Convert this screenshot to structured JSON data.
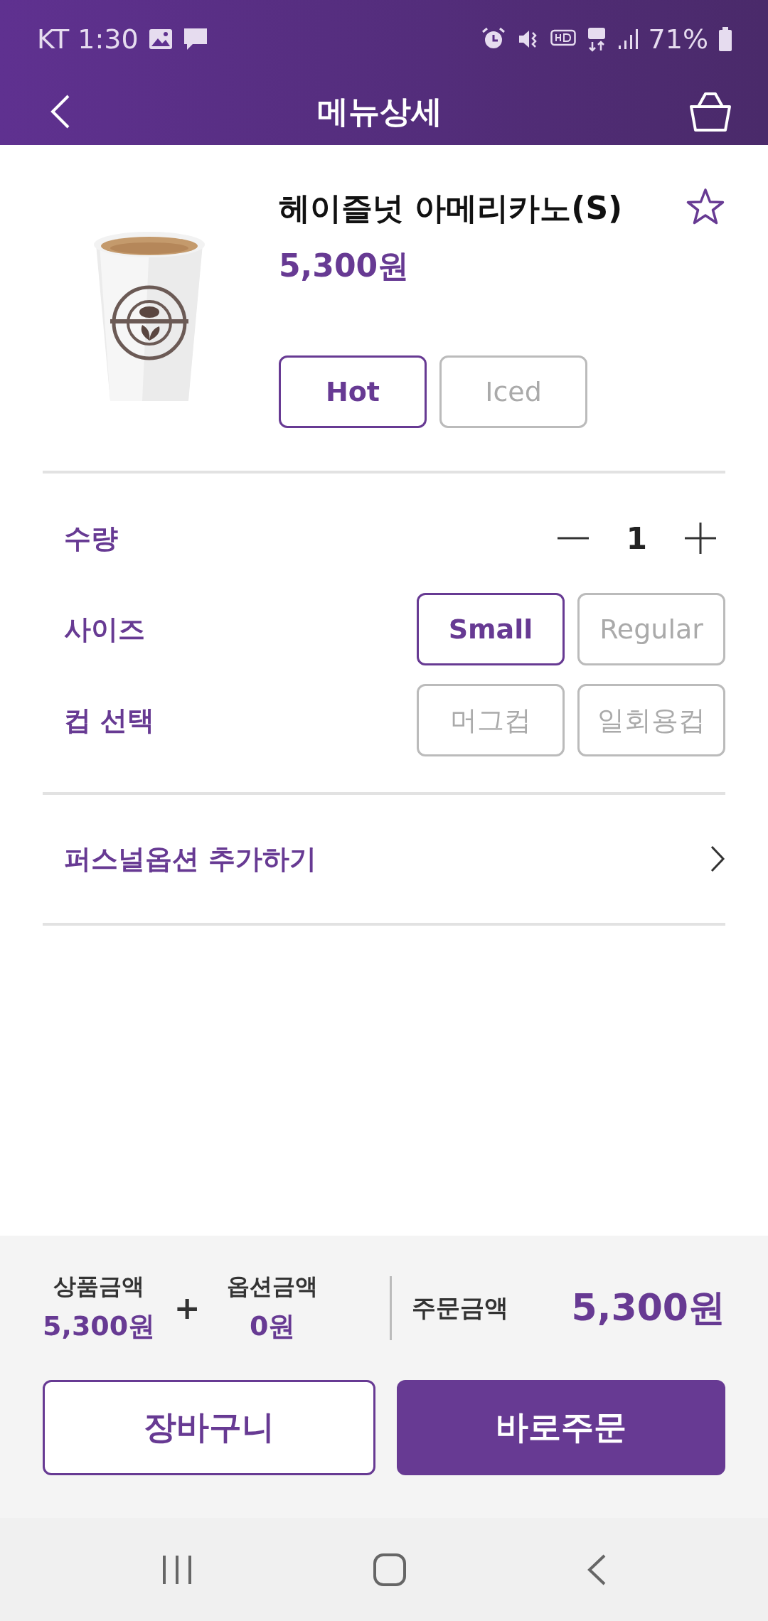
{
  "status_bar": {
    "carrier_time": "KT 1:30",
    "battery": "71%"
  },
  "header": {
    "title": "메뉴상세"
  },
  "product": {
    "kind": "picture",
    "name": "헤이즐넛 아메리카노(S)",
    "price": "5,300원",
    "favorite": false,
    "temperatures": [
      {
        "label": "Hot",
        "selected": true
      },
      {
        "label": "Iced",
        "selected": false
      }
    ]
  },
  "options": [
    {
      "kind": "quantity",
      "label": "수량",
      "value": "1"
    },
    {
      "kind": "choice",
      "label": "사이즈",
      "choices": [
        {
          "label": "Small",
          "selected": true
        },
        {
          "label": "Regular",
          "selected": false
        }
      ]
    },
    {
      "kind": "choice",
      "label": "컵 선택",
      "choices": [
        {
          "label": "머그컵",
          "selected": false
        },
        {
          "label": "일회용컵",
          "selected": false
        }
      ]
    }
  ],
  "personal_option": {
    "label": "퍼스널옵션 추가하기"
  },
  "summary": {
    "product_amount": {
      "label": "상품금액",
      "value": "5,300원"
    },
    "operator": "+",
    "option_amount": {
      "label": "옵션금액",
      "value": "0원"
    },
    "order_amount": {
      "label": "주문금액",
      "value": "5,300원"
    }
  },
  "buttons": [
    {
      "kind": "outline",
      "label": "장바구니"
    },
    {
      "kind": "filled",
      "label": "바로주문"
    }
  ]
}
